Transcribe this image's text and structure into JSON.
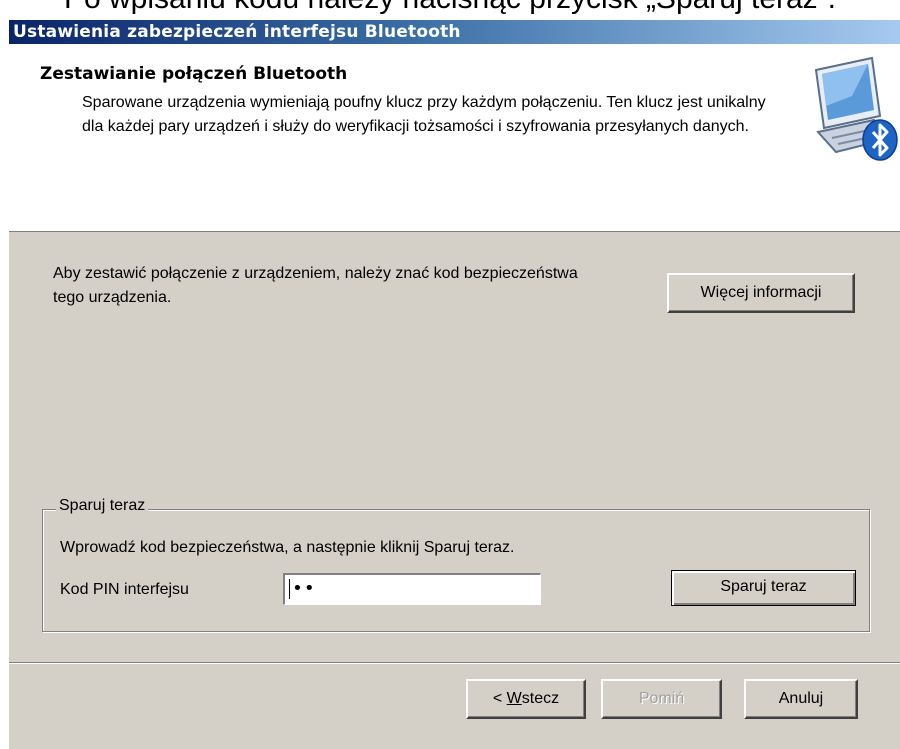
{
  "caption": "Po wpisaniu kodu należy nacisnąć przycisk „Sparuj teraz”.",
  "window": {
    "title": "Ustawienia zabezpieczeń interfejsu Bluetooth"
  },
  "header": {
    "title": "Zestawianie połączeń Bluetooth",
    "description": "Sparowane urządzenia wymieniają poufny klucz przy każdym połączeniu. Ten klucz jest unikalny dla każdej pary urządzeń i służy do weryfikacji tożsamości i szyfrowania przesyłanych danych.",
    "icon": "bluetooth-computer-icon"
  },
  "body": {
    "text": "Aby zestawić połączenie z urządzeniem, należy znać kod bezpieczeństwa tego urządzenia.",
    "more_info_label": "Więcej informacji"
  },
  "pair_group": {
    "legend": "Sparuj teraz",
    "instruction": "Wprowadź kod bezpieczeństwa, a następnie kliknij Sparuj teraz.",
    "pin_label": "Kod PIN interfejsu",
    "pin_value": "••",
    "pair_button_label": "Sparuj teraz"
  },
  "footer": {
    "back_prefix": "< ",
    "back_mnemonic": "W",
    "back_rest": "stecz",
    "skip_label": "Pomiń",
    "cancel_label": "Anuluj"
  },
  "colors": {
    "titlebar_start": "#0a246a",
    "titlebar_end": "#a6caf0",
    "dialog_bg": "#d4d0c8",
    "bluetooth_blue": "#1e63c6"
  }
}
